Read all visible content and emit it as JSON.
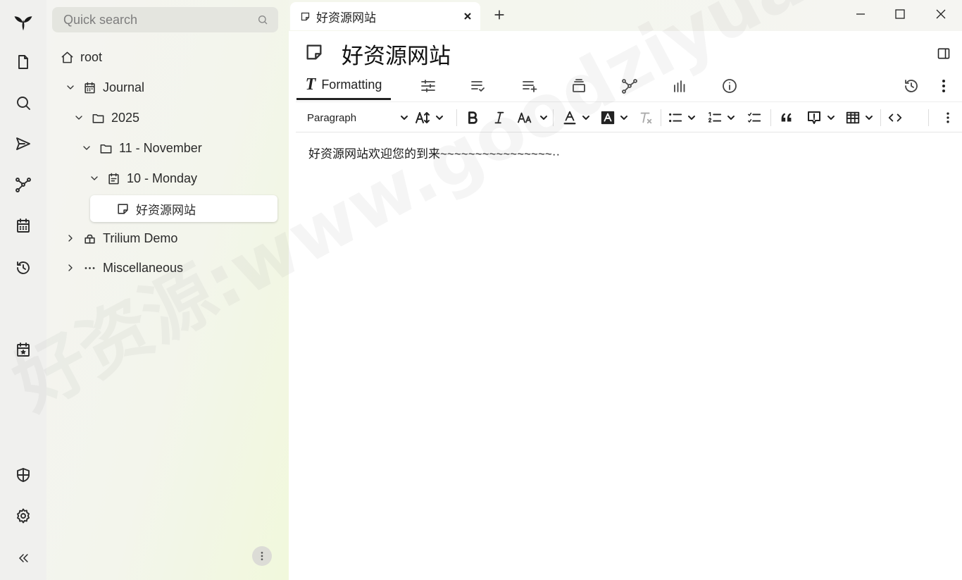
{
  "search": {
    "placeholder": "Quick search"
  },
  "tree": {
    "root": "root",
    "journal": "Journal",
    "year": "2025",
    "month": "11 - November",
    "day": "10 - Monday",
    "note": "好资源网站",
    "demo": "Trilium Demo",
    "misc": "Miscellaneous"
  },
  "tabs": [
    {
      "title": "好资源网站"
    }
  ],
  "note": {
    "title": "好资源网站",
    "content": "好资源网站欢迎您的到来~~~~~~~~~~~~~~~~··"
  },
  "ribbon": {
    "formatting_label": "Formatting"
  },
  "toolbar": {
    "paragraph_label": "Paragraph"
  },
  "watermark": "好资源:www.goodziyuan.com",
  "icons": {
    "launcher": [
      "trilium-logo-icon",
      "new-note-icon",
      "search-icon",
      "send-icon",
      "note-map-icon",
      "calendar-icon",
      "history-icon",
      "today-icon",
      "protected-session-icon",
      "settings-icon",
      "collapse-icon"
    ]
  }
}
